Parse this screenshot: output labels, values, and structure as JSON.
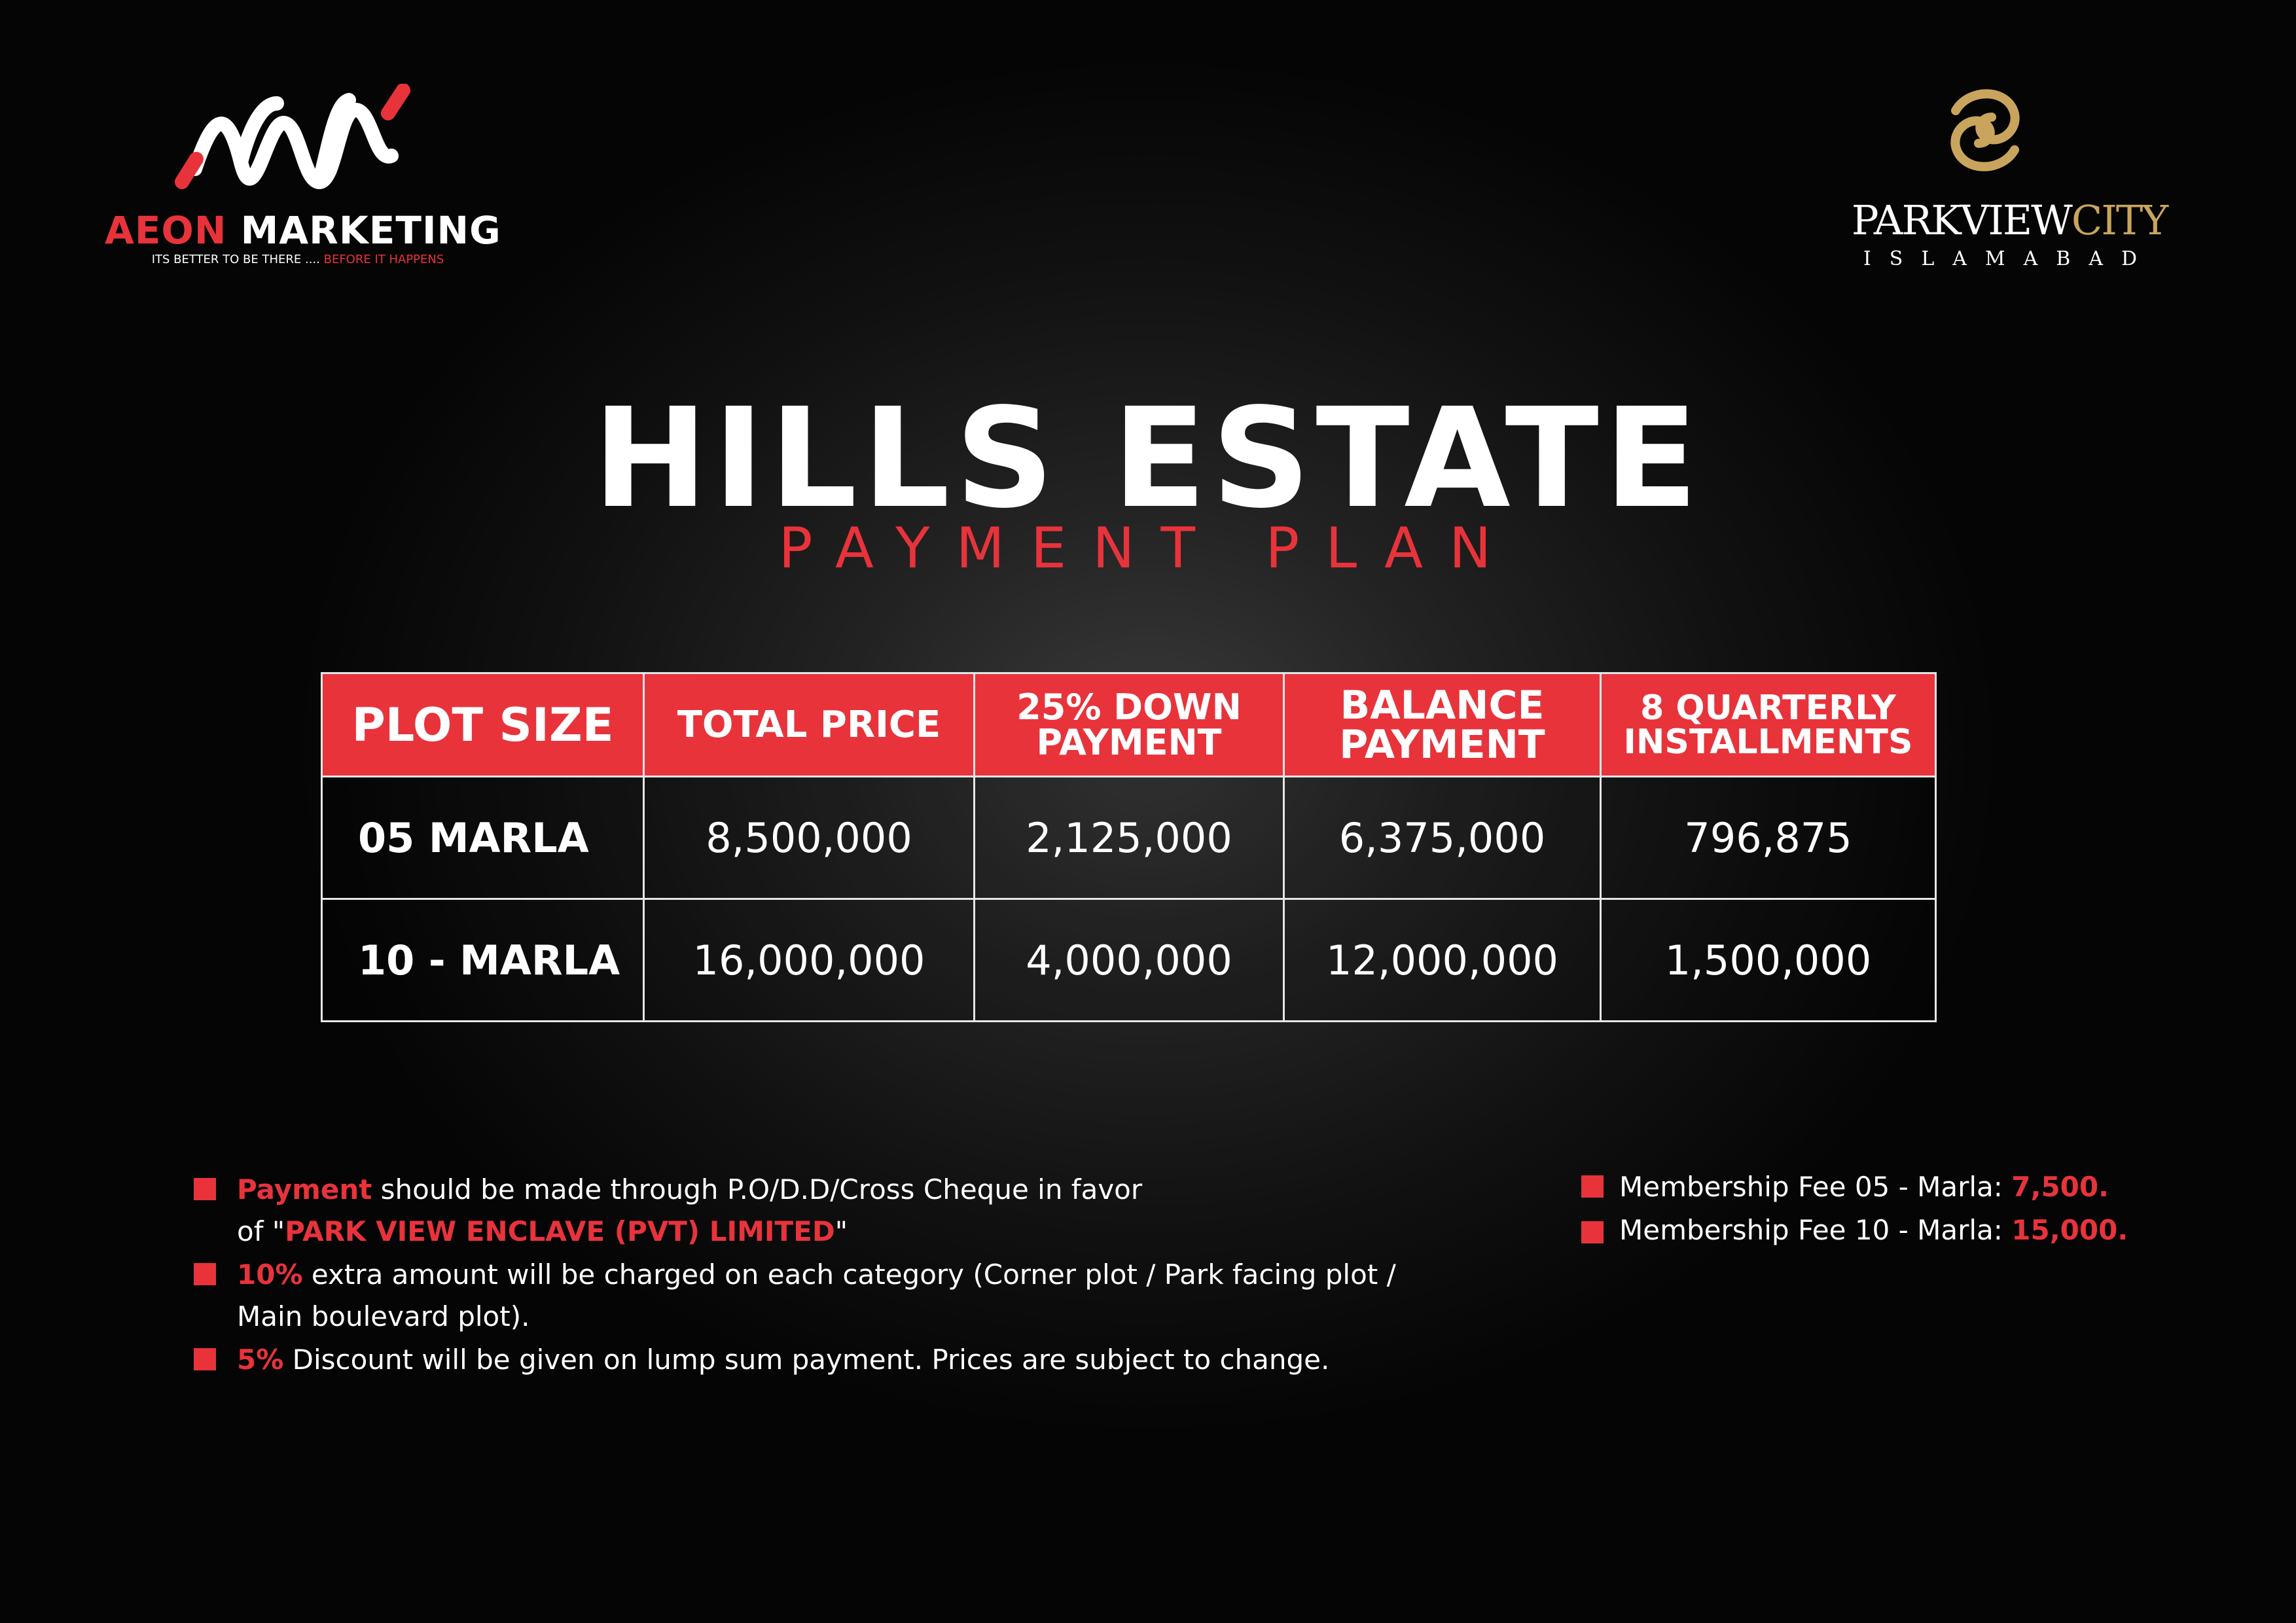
{
  "brand_left": {
    "name_red": "AEON",
    "name_white": "MARKETING",
    "tagline_white": "ITS BETTER TO BE THERE .... ",
    "tagline_red": "BEFORE IT HAPPENS"
  },
  "brand_right": {
    "name_white": "PARKVIEW",
    "name_gold": "CITY",
    "city": "ISLAMABAD"
  },
  "title": "HILLS ESTATE",
  "subtitle": "PAYMENT PLAN",
  "table": {
    "headers": {
      "plot_size": "PLOT SIZE",
      "total_price": "TOTAL PRICE",
      "down_l1": "25% DOWN",
      "down_l2": "PAYMENT",
      "balance_l1": "BALANCE",
      "balance_l2": "PAYMENT",
      "inst_l1": "8 QUARTERLY",
      "inst_l2": "INSTALLMENTS"
    },
    "rows": [
      {
        "size": "05 MARLA",
        "total": "8,500,000",
        "down": "2,125,000",
        "balance": "6,375,000",
        "installment": "796,875"
      },
      {
        "size": "10 - MARLA",
        "total": "16,000,000",
        "down": "4,000,000",
        "balance": "12,000,000",
        "installment": "1,500,000"
      }
    ]
  },
  "notes": {
    "n1_red": "Payment",
    "n1_rest": " should be made through P.O/D.D/Cross Cheque in favor",
    "n1_l2_pre": "of \"",
    "n1_l2_red": "PARK VIEW ENCLAVE (PVT) LIMITED",
    "n1_l2_post": "\"",
    "n2_red": "10%",
    "n2_rest": " extra amount will be charged on each category (Corner plot / Park facing plot /",
    "n2_l2": "Main boulevard plot).",
    "n3_red": "5%",
    "n3_rest": " Discount will be given on lump sum payment. Prices are subject to change."
  },
  "membership": {
    "m1_label": "Membership Fee 05 - Marla: ",
    "m1_value": "7,500.",
    "m2_label": "Membership Fee 10 - Marla: ",
    "m2_value": "15,000."
  },
  "colors": {
    "accent_red": "#e8333b",
    "gold": "#c9a45c",
    "background": "#111111"
  }
}
